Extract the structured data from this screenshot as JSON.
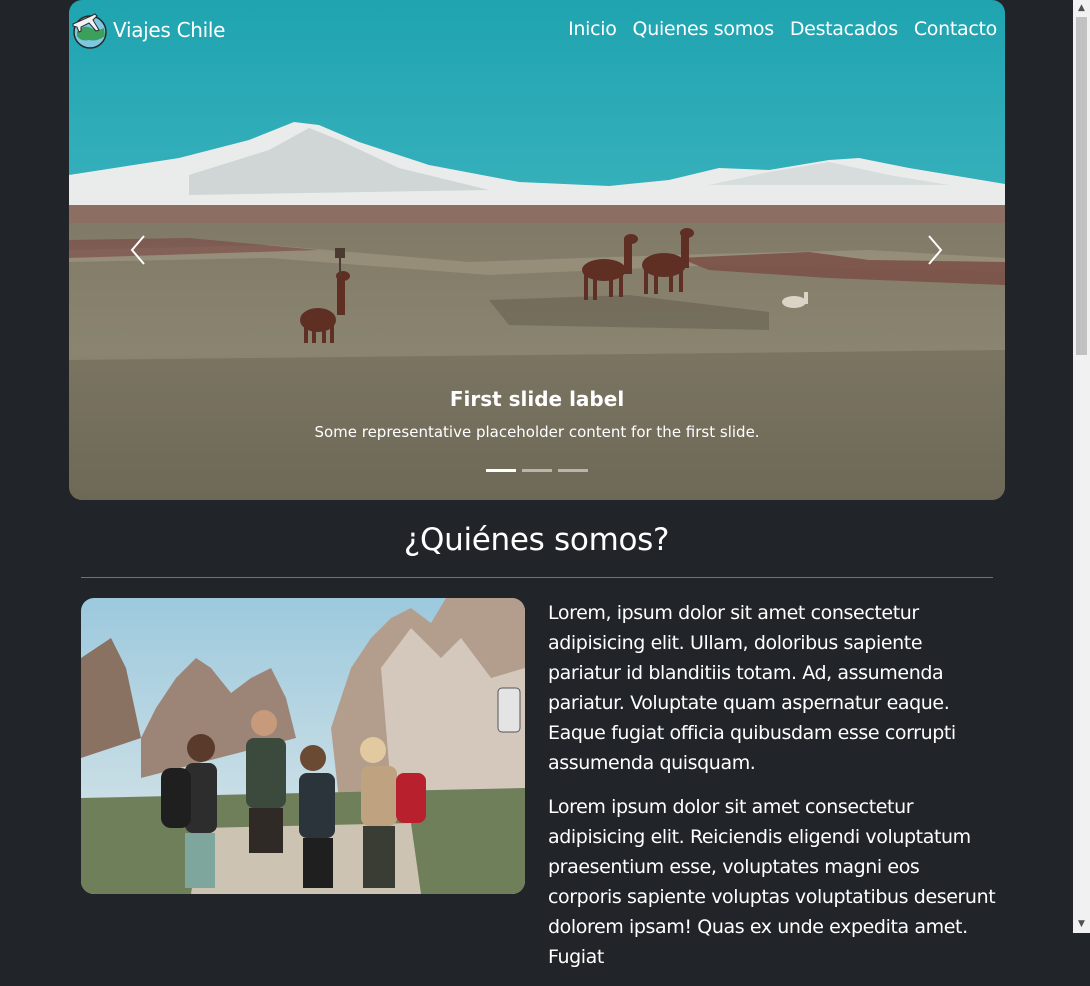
{
  "brand": {
    "name": "Viajes Chile",
    "logo_icon": "globe-plane-icon"
  },
  "nav": {
    "items": [
      "Inicio",
      "Quienes somos",
      "Destacados",
      "Contacto"
    ]
  },
  "carousel": {
    "caption_title": "First slide label",
    "caption_text": "Some representative placeholder content for the first slide.",
    "slide_count": 3,
    "active_index": 0,
    "prev_icon": "chevron-left-icon",
    "next_icon": "chevron-right-icon"
  },
  "about": {
    "title": "¿Quiénes somos?",
    "paragraphs": [
      "Lorem, ipsum dolor sit amet consectetur adipisicing elit. Ullam, doloribus sapiente pariatur id blanditiis totam. Ad, assumenda pariatur. Voluptate quam aspernatur eaque. Eaque fugiat officia quibusdam esse corrupti assumenda quisquam.",
      "Lorem ipsum dolor sit amet consectetur adipisicing elit. Reiciendis eligendi voluptatum praesentium esse, voluptates magni eos corporis sapiente voluptas voluptatibus deserunt dolorem ipsam! Quas ex unde expedita amet. Fugiat"
    ]
  },
  "colors": {
    "background": "#212529",
    "text": "#ffffff",
    "divider": "#6c757d"
  }
}
